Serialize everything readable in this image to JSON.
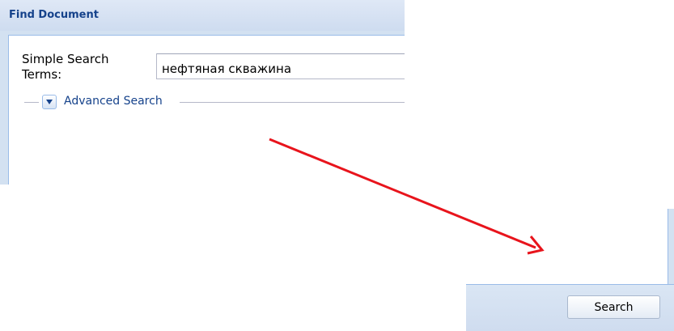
{
  "panel": {
    "title": "Find Document",
    "simple_search_label": "Simple Search Terms:",
    "simple_search_value": "нефтяная скважина",
    "advanced_search_label": "Advanced Search"
  },
  "footer": {
    "search_button_label": "Search"
  },
  "colors": {
    "arrow": "#e8141c",
    "header_text": "#15428b",
    "border": "#99bbe8"
  },
  "icons": {
    "collapse": "chevron-down-icon"
  }
}
